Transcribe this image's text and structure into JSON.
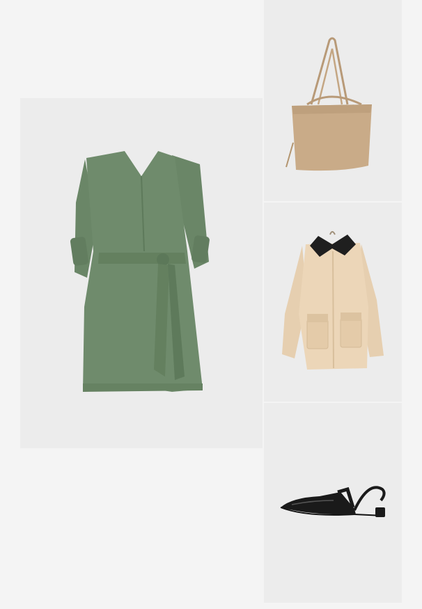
{
  "colors": {
    "page_background": "#f4f4f4",
    "tile_background": "#ececec",
    "dress": "#6f8b6c",
    "bag": "#c9ab88",
    "jacket": "#ecd6b8",
    "jacket_collar": "#1f1f1f",
    "shoe": "#1a1a1a"
  },
  "products": [
    {
      "name": "dress",
      "icon": "green-belted-shirt-dress"
    },
    {
      "name": "bag",
      "icon": "beige-tote-bag"
    },
    {
      "name": "jacket",
      "icon": "beige-utility-jacket"
    },
    {
      "name": "shoe",
      "icon": "black-slingback-flat"
    }
  ]
}
